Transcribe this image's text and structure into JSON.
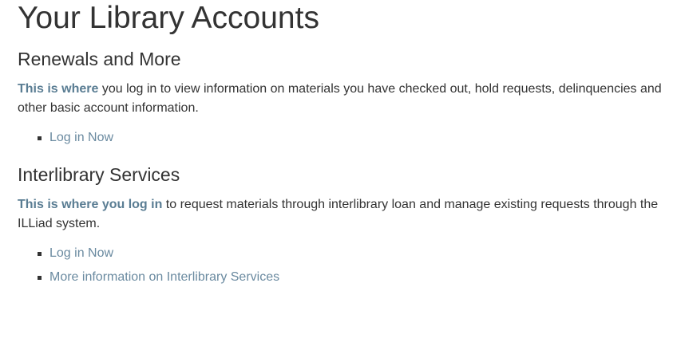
{
  "page_title": "Your Library Accounts",
  "sections": [
    {
      "heading": "Renewals and More",
      "link_text": "This is where",
      "text": " you log in to view information on materials you have checked out, hold requests, delinquencies and other basic account information.",
      "links": [
        "Log in Now"
      ]
    },
    {
      "heading": "Interlibrary Services",
      "link_text": "This is where you log in",
      "text": " to request materials through interlibrary loan and manage existing requests through the ILLiad system.",
      "links": [
        "Log in Now",
        "More information on Interlibrary Services"
      ]
    }
  ],
  "colors": {
    "text": "#333333",
    "link": "#6a8aa0",
    "link_strong": "#5a7d93"
  }
}
